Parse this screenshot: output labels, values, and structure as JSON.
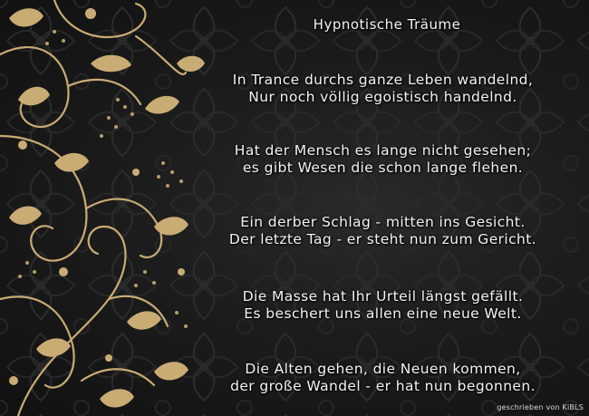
{
  "poem": {
    "title": "Hypnotische Träume",
    "stanzas": [
      {
        "lines": [
          "In Trance durchs ganze Leben wandelnd,",
          "Nur noch völlig egoistisch handelnd."
        ]
      },
      {
        "lines": [
          "Hat der Mensch es lange nicht gesehen;",
          "es gibt Wesen die schon lange flehen."
        ]
      },
      {
        "lines": [
          "Ein derber Schlag - mitten ins Gesicht.",
          "Der letzte Tag - er steht nun zum Gericht."
        ]
      },
      {
        "lines": [
          "Die Masse hat Ihr Urteil längst gefällt.",
          "Es beschert uns allen eine neue Welt."
        ]
      },
      {
        "lines": [
          "Die Alten gehen, die Neuen kommen,",
          "der große Wandel - er hat nun begonnen."
        ]
      }
    ]
  },
  "credit": "geschrieben von KiBLS",
  "colors": {
    "background": "#161616",
    "text": "#f4f4f4",
    "ornament_gold": "#c9ab74"
  },
  "decoration": "gold-floral-swirl-ornament"
}
